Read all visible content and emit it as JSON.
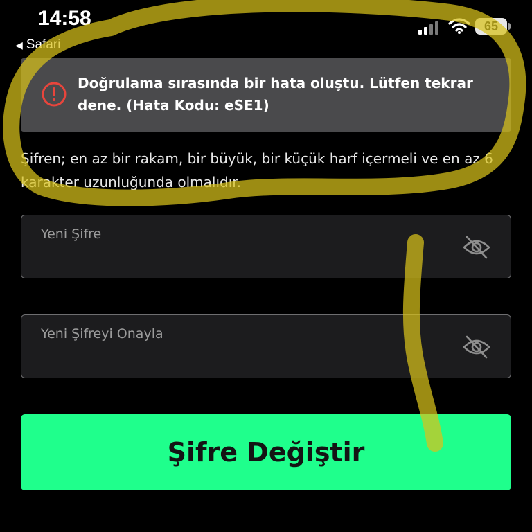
{
  "status_bar": {
    "time": "14:58",
    "back_label": "Safari",
    "battery": "65",
    "icons": [
      "signal-icon",
      "wifi-icon",
      "battery-icon"
    ]
  },
  "error_banner": {
    "icon": "alert-circle-icon",
    "message": "Doğrulama sırasında bir hata oluştu. Lütfen tekrar dene. (Hata Kodu: eSE1)",
    "color": "#e8453c"
  },
  "hint": {
    "text": "Şifren; en az bir rakam, bir büyük, bir küçük harf içermeli ve en az 6 karakter uzunluğunda olmalıdır."
  },
  "fields": [
    {
      "placeholder": "Yeni Şifre",
      "value": "",
      "icon": "eye-off-icon"
    },
    {
      "placeholder": "Yeni Şifreyi Onayla",
      "value": "",
      "icon": "eye-off-icon"
    }
  ],
  "submit": {
    "label": "Şifre Değiştir",
    "color": "#1fff8c"
  },
  "annotation": {
    "color": "#d8c21a"
  }
}
